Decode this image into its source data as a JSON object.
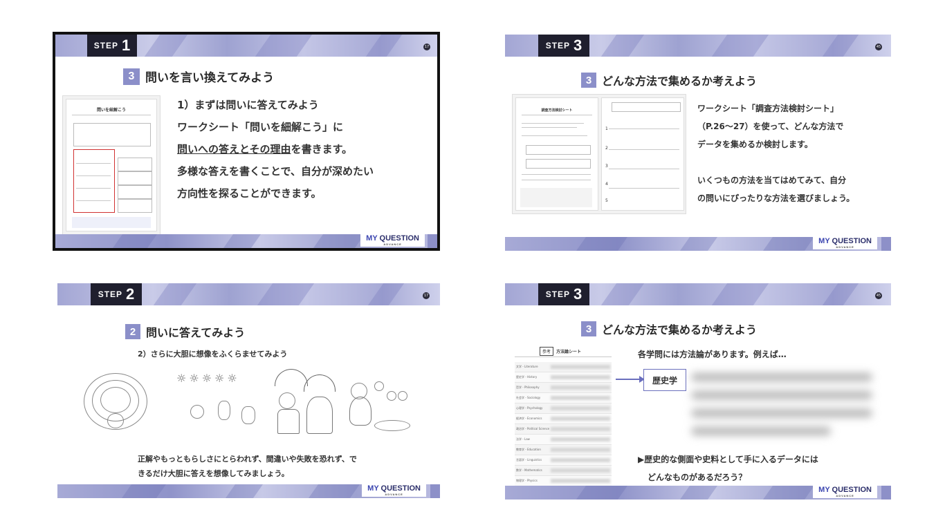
{
  "slides": [
    {
      "step_label": "STEP",
      "step_num": "1",
      "page": "17",
      "section_num": "3",
      "heading": "問いを言い換えてみよう",
      "lines": [
        "1）まずは問いに答えてみよう",
        "ワークシート「問いを細解こう」に",
        "問いへの答えとその理由",
        "を書きます。",
        "多様な答えを書くことで、自分が深めたい",
        "方向性を探ることができます。"
      ],
      "sheet_title": "問いを紐解こう"
    },
    {
      "step_label": "STEP",
      "step_num": "3",
      "page": "45",
      "section_num": "3",
      "heading": "どんな方法で集めるか考えよう",
      "lines": [
        "ワークシート「調査方法検討シート」",
        "（P.26〜27）を使って、どんな方法で",
        "データを集めるか検討します。",
        "いくつもの方法を当てはめてみて、自分",
        "の問いにぴったりな方法を選びましょう。"
      ],
      "sheet_title": "調査方法検討シート",
      "row_numbers": [
        "1",
        "2",
        "3",
        "4",
        "5"
      ]
    },
    {
      "step_label": "STEP",
      "step_num": "2",
      "page": "17",
      "section_num": "2",
      "heading": "問いに答えてみよう",
      "sub": "2）さらに大胆に想像をふくらませてみよう",
      "lines": [
        "正解やもっともらしさにとらわれず、間違いや失敗を恐れず、で",
        "きるだけ大胆に答えを想像してみましょう。"
      ]
    },
    {
      "step_label": "STEP",
      "step_num": "3",
      "page": "45",
      "section_num": "3",
      "heading": "どんな方法で集めるか考えよう",
      "intro": "各学問には方法論があります。例えば…",
      "callout": "歴史学",
      "lines": [
        "▶歴史的な側面や史料として手に入るデータには",
        "どんなものがあるだろう？"
      ],
      "sheet_badge": "参考",
      "sheet_title": "方法論シート",
      "sheet_rows": [
        "文学 - Literature",
        "歴史学 - History",
        "哲学 - Philosophy",
        "社会学 - Sociology",
        "心理学 - Psychology",
        "経済学 - Economics",
        "政治学 - Political Science",
        "法学 - Law",
        "教育学 - Education",
        "言語学 - Linguistics",
        "数学 - Mathematics",
        "物理学 - Physics"
      ]
    }
  ],
  "brand": {
    "my": "MY",
    "question": "QUESTION",
    "sub": "ADVANCE"
  },
  "colors": {
    "accent": "#8b8fc9",
    "bar": "#a3a6d4",
    "highlight": "#d03030"
  }
}
